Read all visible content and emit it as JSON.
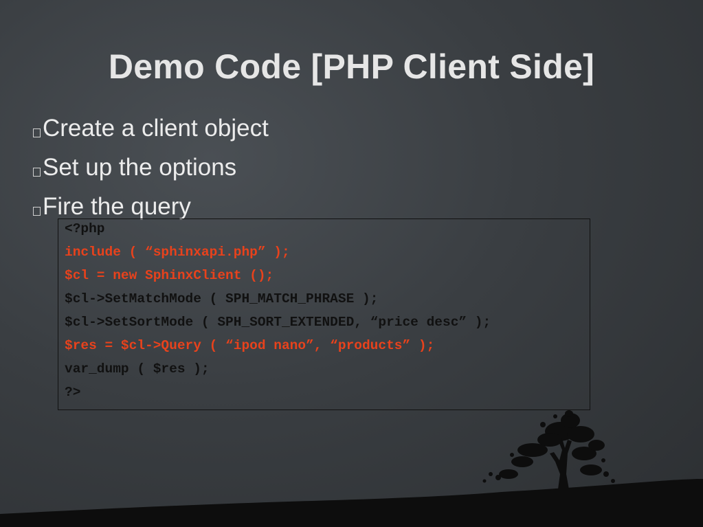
{
  "slide": {
    "title": "Demo Code [PHP Client Side]",
    "bullets": [
      {
        "label": "Create a client object"
      },
      {
        "label": "Set up the options"
      },
      {
        "label": "Fire the query"
      }
    ],
    "code_lines": [
      {
        "text": "<?php",
        "highlight": false
      },
      {
        "text": "include ( “sphinxapi.php” );",
        "highlight": true
      },
      {
        "text": "$cl = new SphinxClient ();",
        "highlight": true
      },
      {
        "text": "$cl->SetMatchMode ( SPH_MATCH_PHRASE );",
        "highlight": false
      },
      {
        "text": "$cl->SetSortMode ( SPH_SORT_EXTENDED, “price desc” );",
        "highlight": false
      },
      {
        "text": "$res = $cl->Query ( “ipod nano”, “products” );",
        "highlight": true
      },
      {
        "text": "var_dump ( $res );",
        "highlight": false
      },
      {
        "text": "?>",
        "highlight": false
      }
    ]
  },
  "colors": {
    "background": "#3a3e42",
    "title": "#e6e6e6",
    "bullet_text": "#ececec",
    "code_text": "#111111",
    "code_highlight": "#e8421c",
    "ground": "#0d0d0d"
  },
  "icons": {
    "bullet": "square-bullet-icon",
    "tree": "tree-silhouette-icon"
  }
}
